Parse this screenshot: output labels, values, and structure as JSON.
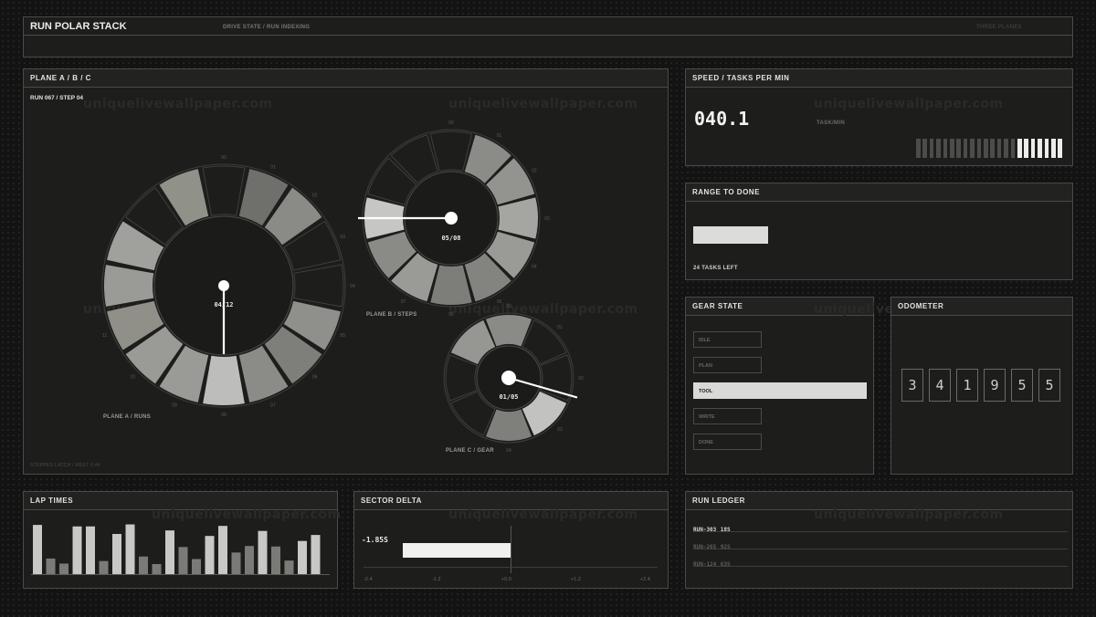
{
  "header": {
    "title": "RUN POLAR STACK",
    "subtitle": "DRIVE STATE / RUN INDEXING",
    "right_label": "THREE PLANES"
  },
  "watermark": "uniquelivewallpaper.com",
  "planes": {
    "title": "PLANE A / B / C",
    "run_label": "RUN 067 / STEP 04",
    "footer_note": "STEPPED LATCH / REST 0.44",
    "plane_a": {
      "caption": "PLANE A / RUNS",
      "counter": "04/12",
      "ticks": [
        "00",
        "01",
        "02",
        "03",
        "04",
        "05",
        "06",
        "07",
        "08",
        "09",
        "10",
        "11"
      ]
    },
    "plane_b": {
      "caption": "PLANE B / STEPS",
      "counter": "05/08",
      "ticks": [
        "00",
        "01",
        "02",
        "03",
        "04",
        "05",
        "06",
        "07"
      ]
    },
    "plane_c": {
      "caption": "PLANE C / GEAR",
      "counter": "01/05",
      "ticks": [
        "00",
        "01",
        "02",
        "03",
        "04"
      ]
    }
  },
  "speed": {
    "title": "SPEED / TASKS PER MIN",
    "value": "040.1",
    "unit": "TASK/MIN",
    "level": 0.33
  },
  "range": {
    "title": "RANGE TO DONE",
    "caption": "24 TASKS LEFT",
    "progress": 0.2
  },
  "gear": {
    "title": "GEAR STATE",
    "options": [
      "IDLE",
      "PLAN",
      "TOOL",
      "WRITE",
      "DONE"
    ],
    "selected": "TOOL"
  },
  "odometer": {
    "title": "ODOMETER",
    "digits": [
      "3",
      "4",
      "1",
      "9",
      "5",
      "5"
    ]
  },
  "lap_times": {
    "title": "LAP TIMES"
  },
  "sector_delta": {
    "title": "SECTOR DELTA",
    "value": "-1.85S",
    "ticks": [
      "-2.4",
      "-1.2",
      "+0.0",
      "+1.2",
      "+2.4"
    ]
  },
  "ledger": {
    "title": "RUN LEDGER",
    "rows": [
      {
        "id": "RUN-303",
        "time": "18S"
      },
      {
        "id": "RUN-265",
        "time": "92S"
      },
      {
        "id": "RUN-124",
        "time": "63S"
      }
    ]
  },
  "chart_data": {
    "type": "bar",
    "title": "LAP TIMES",
    "values": [
      0.98,
      0.31,
      0.21,
      0.95,
      0.95,
      0.26,
      0.8,
      0.99,
      0.35,
      0.2,
      0.87,
      0.54,
      0.3,
      0.76,
      0.96,
      0.43,
      0.56,
      0.86,
      0.55,
      0.27,
      0.66,
      0.78
    ],
    "ylim": [
      0,
      1
    ]
  }
}
